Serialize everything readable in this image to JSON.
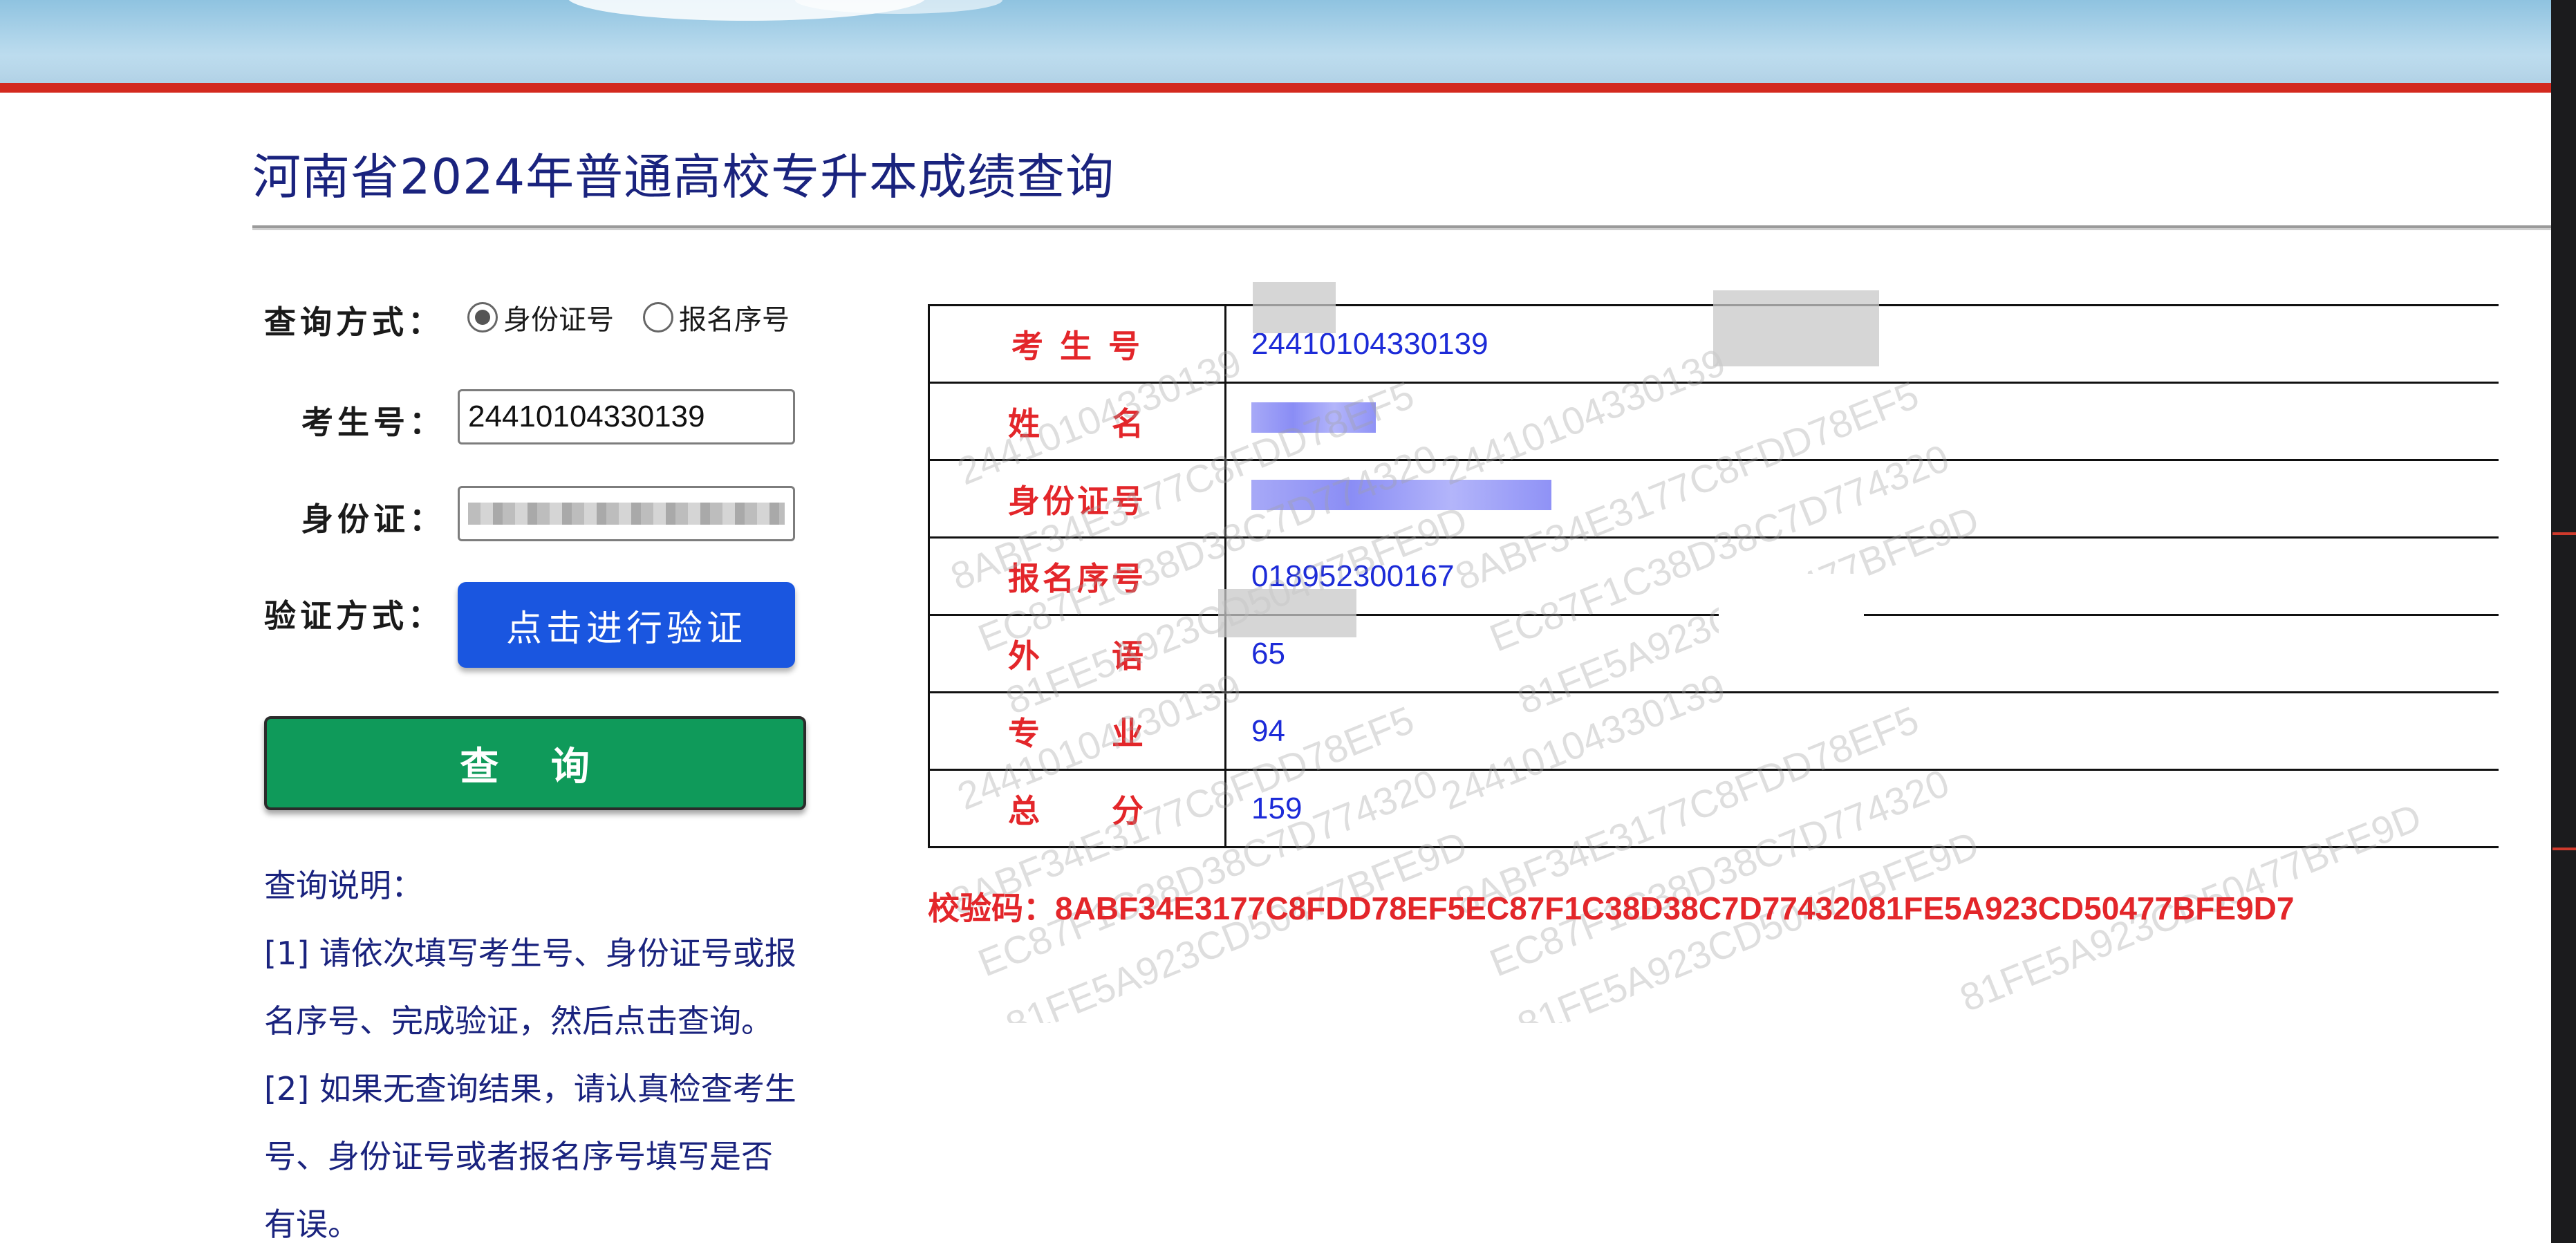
{
  "page": {
    "title": "河南省2024年普通高校专升本成绩查询"
  },
  "form": {
    "query_mode_label": "查询方式：",
    "radio_options": [
      {
        "label": "身份证号",
        "checked": true
      },
      {
        "label": "报名序号",
        "checked": false
      }
    ],
    "exam_no_label": "考生号：",
    "exam_no_value": "24410104330139",
    "id_label": "身份证：",
    "verify_label": "验证方式：",
    "verify_button": "点击进行验证",
    "query_button": "查 询"
  },
  "notes": {
    "heading": "查询说明：",
    "lines": [
      "[1] 请依次填写考生号、身份证号或报",
      "名序号、完成验证，然后点击查询。",
      "[2] 如果无查询结果，请认真检查考生",
      "号、身份证号或者报名序号填写是否",
      "有误。"
    ]
  },
  "result": {
    "rows": [
      {
        "key": "考 生 号",
        "value": "24410104330139",
        "blurred": false
      },
      {
        "key": "姓　　名",
        "value": "",
        "blurred": true
      },
      {
        "key": "身份证号",
        "value": "",
        "blurred": true
      },
      {
        "key": "报名序号",
        "value": "018952300167",
        "blurred": false
      },
      {
        "key": "外　　语",
        "value": "65",
        "blurred": false
      },
      {
        "key": "专　　业",
        "value": "94",
        "blurred": false
      },
      {
        "key": "总　　分",
        "value": "159",
        "blurred": false
      }
    ],
    "checkcode_label": "校验码：",
    "checkcode_value": "8ABF34E3177C8FDD78EF5EC87F1C38D38C7D77432081FE5A923CD50477BFE9D7"
  },
  "watermark": {
    "lines": [
      "24410104330139",
      "8ABF34E3177C8FDD78EF5",
      "EC87F1C38D38C7D774320",
      "81FE5A923CD50477BFE9D"
    ]
  },
  "colors": {
    "accent_red": "#e3262a",
    "value_blue": "#1c2bd8",
    "title_navy": "#1a237e",
    "verify_blue": "#1a56e0",
    "query_green": "#0f9a5a"
  }
}
